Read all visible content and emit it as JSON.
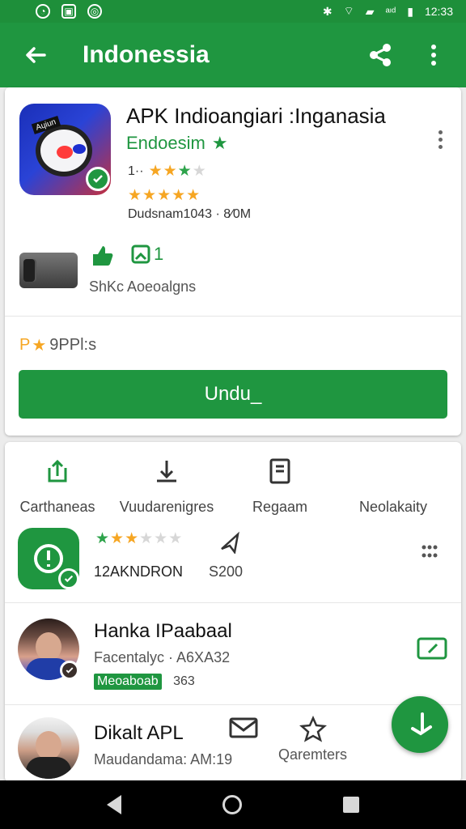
{
  "status_bar": {
    "time": "12:33",
    "signal_text": "ᵃᶦᵈ"
  },
  "app_bar": {
    "title": "Indonessia"
  },
  "app": {
    "name": "APK Indioangiari :Inganasia",
    "developer": "Endoesim",
    "rating_prefix": "1··",
    "meta": "Dudsnam1043 · 8⁄0M",
    "reviews": "ShKc Aoeoalgns",
    "count": "1",
    "price_prefix": "P",
    "price_text": "9PPl:s",
    "install_label": "Undu_"
  },
  "tabs": [
    {
      "label": "Carthaneas",
      "icon": "share-icon"
    },
    {
      "label": "Vuudarenigres",
      "icon": "download-icon"
    },
    {
      "label": "Regaam",
      "icon": "document-icon"
    },
    {
      "label": "Neolakaity",
      "icon": "more-icon"
    }
  ],
  "list": [
    {
      "type": "app",
      "name_left": "12AKNDRON",
      "name_right": "S200",
      "icon": "shield-icon"
    },
    {
      "type": "person",
      "title": "Hanka IPaabaal",
      "subtitle": "Facentalyc · A6XA32",
      "tag": "Meoaboab",
      "tag_value": "363"
    },
    {
      "type": "person",
      "title": "Dikalt APL",
      "subtitle": "Maudandama: AM:19"
    }
  ],
  "bottom_action": {
    "label": "Qaremters"
  },
  "colors": {
    "primary": "#1f9640",
    "accent": "#f6a623"
  }
}
